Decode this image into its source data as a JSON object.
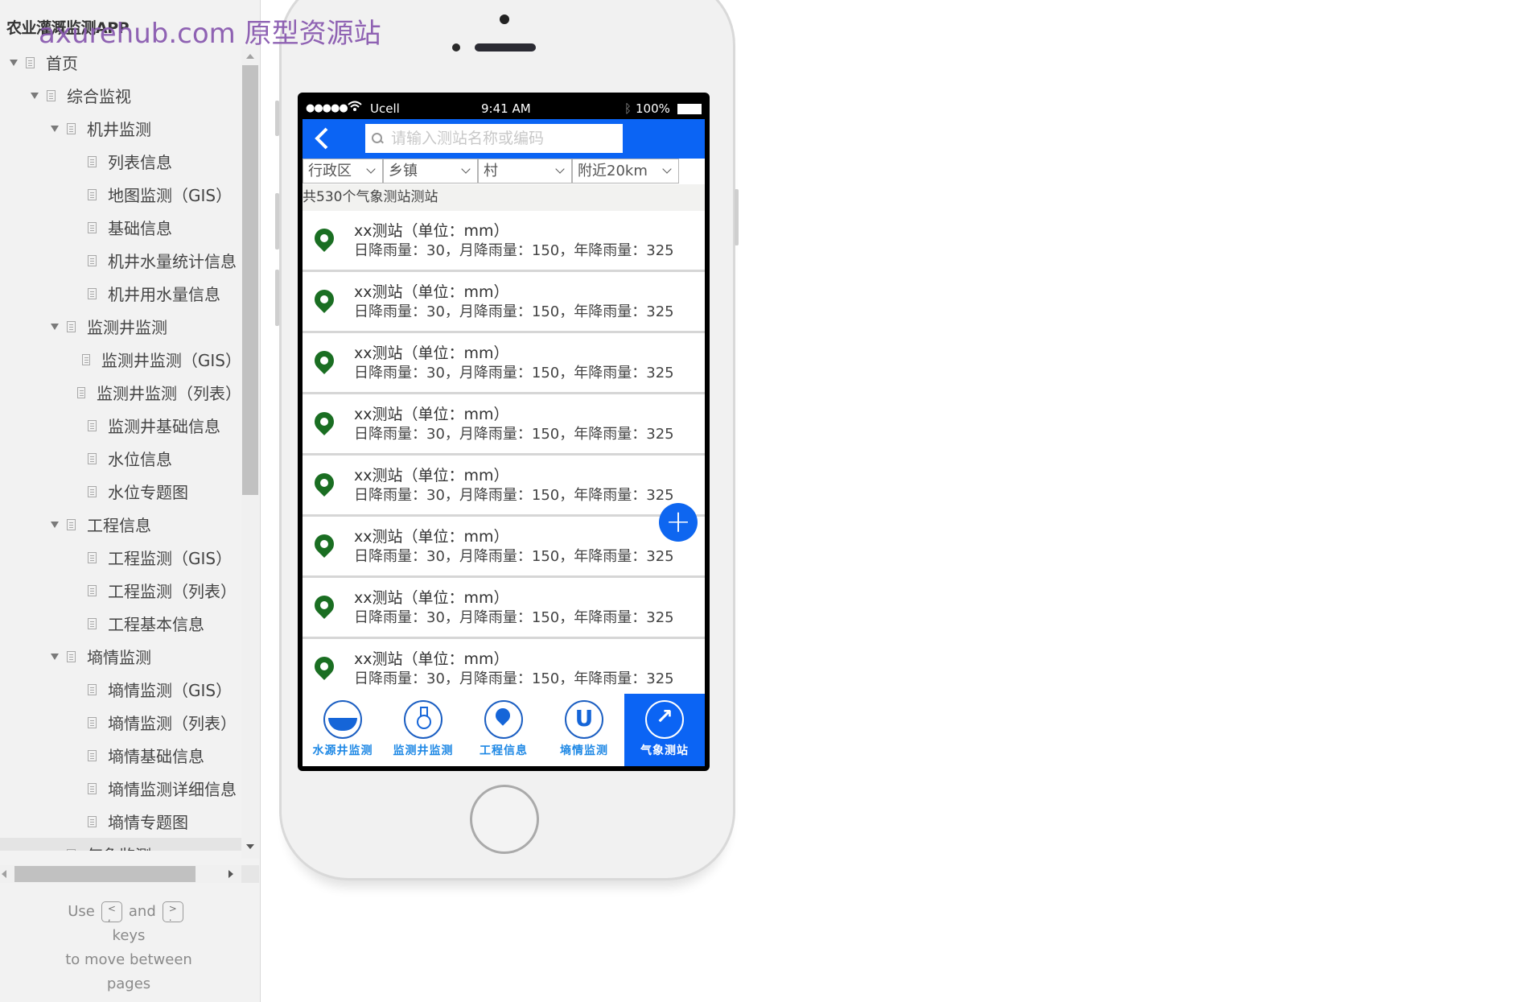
{
  "sidebar": {
    "app_title": "农业灌溉监测APP",
    "watermark": "axurehub.com 原型资源站",
    "tree": [
      {
        "label": "首页",
        "level": 0,
        "expanded": true
      },
      {
        "label": "综合监视",
        "level": 1,
        "expanded": true
      },
      {
        "label": "机井监测",
        "level": 2,
        "expanded": true
      },
      {
        "label": "列表信息",
        "level": 3
      },
      {
        "label": "地图监测（GIS）",
        "level": 3
      },
      {
        "label": "基础信息",
        "level": 3
      },
      {
        "label": "机井水量统计信息",
        "level": 3
      },
      {
        "label": "机井用水量信息",
        "level": 3
      },
      {
        "label": "监测井监测",
        "level": 2,
        "expanded": true
      },
      {
        "label": "监测井监测（GIS）",
        "level": 3
      },
      {
        "label": "监测井监测（列表）",
        "level": 3
      },
      {
        "label": "监测井基础信息",
        "level": 3
      },
      {
        "label": "水位信息",
        "level": 3
      },
      {
        "label": "水位专题图",
        "level": 3
      },
      {
        "label": "工程信息",
        "level": 2,
        "expanded": true
      },
      {
        "label": "工程监测（GIS）",
        "level": 3
      },
      {
        "label": "工程监测（列表）",
        "level": 3
      },
      {
        "label": "工程基本信息",
        "level": 3
      },
      {
        "label": "墒情监测",
        "level": 2,
        "expanded": true
      },
      {
        "label": "墒情监测（GIS）",
        "level": 3
      },
      {
        "label": "墒情监测（列表）",
        "level": 3
      },
      {
        "label": "墒情基础信息",
        "level": 3
      },
      {
        "label": "墒情监测详细信息",
        "level": 3
      },
      {
        "label": "墒情专题图",
        "level": 3
      },
      {
        "label": "气象监测",
        "level": 2,
        "expanded": true,
        "selected": true
      }
    ],
    "help": {
      "use": "Use",
      "key_prev": "<\n,",
      "and": "and",
      "key_next": ">\n.",
      "keys": "keys",
      "line3": "to move between",
      "line4": "pages"
    }
  },
  "phone": {
    "status_bar": {
      "signal": "●●●●●",
      "wifi": "wifi-icon",
      "carrier": "Ucell",
      "time": "9:41 AM",
      "bluetooth": "bluetooth-icon",
      "battery": "100%"
    },
    "header": {
      "back_icon": "chevron-left-icon",
      "search_placeholder": "请输入测站名称或编码",
      "search_value": ""
    },
    "filters": [
      {
        "label": "行政区"
      },
      {
        "label": "乡镇"
      },
      {
        "label": "村"
      },
      {
        "label": "附近20km"
      }
    ],
    "count_text": "共530个气象测站测站",
    "stations": [
      {
        "name": "xx测站（单位：mm）",
        "detail": "日降雨量：30，月降雨量：150，年降雨量：325"
      },
      {
        "name": "xx测站（单位：mm）",
        "detail": "日降雨量：30，月降雨量：150，年降雨量：325"
      },
      {
        "name": "xx测站（单位：mm）",
        "detail": "日降雨量：30，月降雨量：150，年降雨量：325"
      },
      {
        "name": "xx测站（单位：mm）",
        "detail": "日降雨量：30，月降雨量：150，年降雨量：325"
      },
      {
        "name": "xx测站（单位：mm）",
        "detail": "日降雨量：30，月降雨量：150，年降雨量：325"
      },
      {
        "name": "xx测站（单位：mm）",
        "detail": "日降雨量：30，月降雨量：150，年降雨量：325"
      },
      {
        "name": "xx测站（单位：mm）",
        "detail": "日降雨量：30，月降雨量：150，年降雨量：325"
      },
      {
        "name": "xx测站（单位：mm）",
        "detail": "日降雨量：30，月降雨量：150，年降雨量：325"
      }
    ],
    "fab_label": "+",
    "tabs": [
      {
        "label": "水源井监测",
        "icon": "water-well-icon",
        "active": false
      },
      {
        "label": "监测井监测",
        "icon": "flask-icon",
        "active": false
      },
      {
        "label": "工程信息",
        "icon": "location-pin-icon",
        "active": false
      },
      {
        "label": "墒情监测",
        "icon": "u-tube-icon",
        "active": false
      },
      {
        "label": "气象测站",
        "icon": "gauge-icon",
        "active": true
      }
    ],
    "colors": {
      "primary": "#0b64f4",
      "pin": "#1a6e22",
      "tab_text": "#1e88e5"
    }
  }
}
